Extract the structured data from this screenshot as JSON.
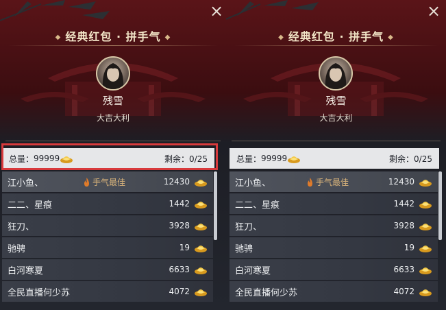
{
  "panels": [
    {
      "title": "经典红包 · 拼手气",
      "sender_name": "残雪",
      "blessing": "大吉大利",
      "total_label": "总量：",
      "total_value": "99999",
      "remaining_label": "剩余：",
      "remaining_value": "0/25",
      "best_tag": "手气最佳",
      "rows": [
        {
          "name": "江小鱼、",
          "amount": "12430",
          "best": true
        },
        {
          "name": "二二、星痕",
          "amount": "1442",
          "best": false
        },
        {
          "name": "狂刀、",
          "amount": "3928",
          "best": false
        },
        {
          "name": "驰骋",
          "amount": "19",
          "best": false
        },
        {
          "name": "白河寒夏",
          "amount": "6633",
          "best": false
        },
        {
          "name": "全民直播何少苏",
          "amount": "4072",
          "best": false
        }
      ]
    },
    {
      "title": "经典红包 · 拼手气",
      "sender_name": "残雪",
      "blessing": "大吉大利",
      "total_label": "总量：",
      "total_value": "99999",
      "remaining_label": "剩余：",
      "remaining_value": "0/25",
      "best_tag": "手气最佳",
      "rows": [
        {
          "name": "江小鱼、",
          "amount": "12430",
          "best": true
        },
        {
          "name": "二二、星痕",
          "amount": "1442",
          "best": false
        },
        {
          "name": "狂刀、",
          "amount": "3928",
          "best": false
        },
        {
          "name": "驰骋",
          "amount": "19",
          "best": false
        },
        {
          "name": "白河寒夏",
          "amount": "6633",
          "best": false
        },
        {
          "name": "全民直播何少苏",
          "amount": "4072",
          "best": false
        }
      ]
    }
  ],
  "icons": {
    "close": "close-icon",
    "currency": "gold-ingot-icon",
    "best_luck": "flame-icon"
  },
  "colors": {
    "highlight_border": "#d83a3c",
    "banner_red": "#5a1418",
    "gold": "#e9b93a"
  }
}
